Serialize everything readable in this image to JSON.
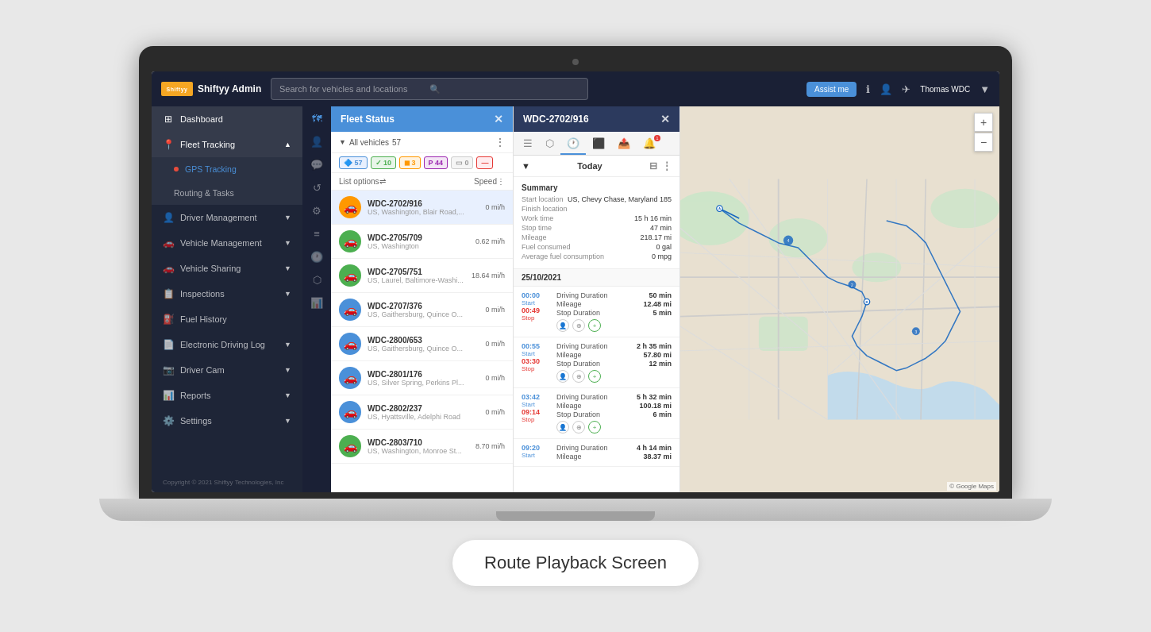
{
  "app": {
    "title": "Shiftyy Admin",
    "logo_text": "Shiftyy",
    "caption": "Route Playback Screen"
  },
  "topbar": {
    "brand": "Shiftyy Admin",
    "search_placeholder": "Search for vehicles and locations",
    "assist_btn": "Assist me",
    "user": "Thomas WDC"
  },
  "sidebar": {
    "items": [
      {
        "id": "dashboard",
        "label": "Dashboard",
        "icon": "⊞"
      },
      {
        "id": "fleet-tracking",
        "label": "Fleet Tracking",
        "icon": "📍",
        "active": true,
        "arrow": "▲"
      },
      {
        "id": "gps-tracking",
        "label": "GPS Tracking",
        "icon": "",
        "sub": true,
        "active_sub": true
      },
      {
        "id": "routing-tasks",
        "label": "Routing & Tasks",
        "icon": "",
        "sub": true
      },
      {
        "id": "driver-management",
        "label": "Driver Management",
        "icon": "👤",
        "arrow": "▼"
      },
      {
        "id": "vehicle-management",
        "label": "Vehicle Management",
        "icon": "🚗",
        "arrow": "▼"
      },
      {
        "id": "vehicle-sharing",
        "label": "Vehicle Sharing",
        "icon": "🚗",
        "arrow": "▼"
      },
      {
        "id": "inspections",
        "label": "Inspections",
        "icon": "📋",
        "arrow": "▼"
      },
      {
        "id": "fuel-history",
        "label": "Fuel History",
        "icon": "⛽"
      },
      {
        "id": "electronic-log",
        "label": "Electronic Driving Log",
        "icon": "📄",
        "arrow": "▼"
      },
      {
        "id": "driver-cam",
        "label": "Driver Cam",
        "icon": "📷",
        "arrow": "▼"
      },
      {
        "id": "reports",
        "label": "Reports",
        "icon": "📊",
        "arrow": "▼"
      },
      {
        "id": "settings",
        "label": "Settings",
        "icon": "⚙️",
        "arrow": "▼"
      }
    ],
    "copyright": "Copyright © 2021 Shiftyy Technologies, Inc"
  },
  "fleet_status": {
    "title": "Fleet Status",
    "filter_label": "All vehicles",
    "filter_count": "57",
    "badges": [
      {
        "type": "blue",
        "count": "57"
      },
      {
        "type": "green",
        "count": "10"
      },
      {
        "type": "orange",
        "count": "3"
      },
      {
        "type": "purple",
        "count": "44"
      },
      {
        "type": "gray",
        "count": "0"
      },
      {
        "type": "red",
        "count": "—"
      }
    ],
    "list_options": "List options",
    "speed_label": "Speed",
    "vehicles": [
      {
        "id": "WDC-2702/916",
        "location": "US, Washington, Blair Road,...",
        "speed": "0 mi/h",
        "color": "orange",
        "selected": true
      },
      {
        "id": "WDC-2705/709",
        "location": "US, Washington",
        "speed": "0.62 mi/h",
        "color": "green"
      },
      {
        "id": "WDC-2705/751",
        "location": "US, Laurel, Baltimore-Washi...",
        "speed": "18.64 mi/h",
        "color": "green"
      },
      {
        "id": "WDC-2707/376",
        "location": "US, Gaithersburg, Quince O...",
        "speed": "0 mi/h",
        "color": "blue"
      },
      {
        "id": "WDC-2800/653",
        "location": "US, Gaithersburg, Quince O...",
        "speed": "0 mi/h",
        "color": "blue"
      },
      {
        "id": "WDC-2801/176",
        "location": "US, Silver Spring, Perkins Pl...",
        "speed": "0 mi/h",
        "color": "blue"
      },
      {
        "id": "WDC-2802/237",
        "location": "US, Hyattsville, Adelphi Road",
        "speed": "0 mi/h",
        "color": "blue"
      },
      {
        "id": "WDC-2803/710",
        "location": "US, Washington, Monroe St...",
        "speed": "8.70 mi/h",
        "color": "green"
      }
    ]
  },
  "detail_panel": {
    "vehicle_id": "WDC-2702/916",
    "tabs": [
      {
        "id": "info",
        "icon": "☰"
      },
      {
        "id": "graph",
        "icon": "⬡"
      },
      {
        "id": "history",
        "icon": "🕐"
      },
      {
        "id": "copy",
        "icon": "⬛"
      },
      {
        "id": "share",
        "icon": "📤"
      },
      {
        "id": "alert",
        "icon": "🔔",
        "badge": "1"
      }
    ],
    "today_label": "Today",
    "summary": {
      "title": "Summary",
      "start_location": "US, Chevy Chase, Maryland 185",
      "finish_location": "",
      "work_time": "15 h 16 min",
      "stop_time": "47 min",
      "mileage": "218.17 mi",
      "fuel_consumed": "0 gal",
      "avg_fuel": "0 mpg"
    },
    "date": "25/10/2021",
    "timeline": [
      {
        "start_time": "00:00",
        "start_label": "Start",
        "stop_time": "00:49",
        "stop_label": "Stop",
        "driving_duration": "50 min",
        "mileage": "12.48 mi",
        "stop_duration": "5 min"
      },
      {
        "start_time": "00:55",
        "start_label": "Start",
        "stop_time": "03:30",
        "stop_label": "Stop",
        "driving_duration": "2 h 35 min",
        "mileage": "57.80 mi",
        "stop_duration": "12 min"
      },
      {
        "start_time": "03:42",
        "start_label": "Start",
        "stop_time": "09:14",
        "stop_label": "Stop",
        "driving_duration": "5 h 32 min",
        "mileage": "100.18 mi",
        "stop_duration": "6 min"
      },
      {
        "start_time": "09:20",
        "start_label": "Start",
        "driving_duration": "4 h 14 min",
        "mileage": "38.37 mi"
      }
    ]
  },
  "map": {
    "zoom_plus": "+",
    "zoom_minus": "−",
    "attribution": "© Google Maps"
  }
}
